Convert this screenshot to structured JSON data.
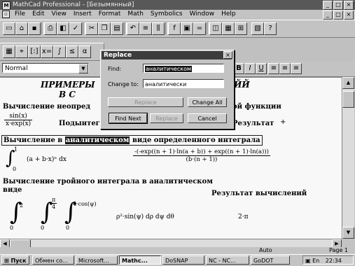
{
  "window": {
    "title": "MathCad Professional - [Безымянный]",
    "controls": [
      "_",
      "□",
      "×"
    ]
  },
  "menubar": {
    "items": [
      "File",
      "Edit",
      "View",
      "Insert",
      "Format",
      "Math",
      "Symbolics",
      "Window",
      "Help"
    ]
  },
  "format_bar": {
    "style_value": "Normal",
    "bold": "B",
    "italic": "I",
    "underline": "U"
  },
  "document": {
    "heading1": "ПРИМЕРЫ",
    "heading1_end": "ЙЙ",
    "heading2": "В С",
    "line1_left": "Вычисление неопред",
    "line1_right": "ой функции",
    "frac1_num": "sin(x)",
    "frac1_den": "x·exp(x)",
    "line2_mid": "Подынтегр",
    "line2_right": "Результат",
    "line3_pre": "Вычисление в",
    "line3_highlight": "аналитическом",
    "line3_post": "виде определенного интеграла",
    "int1_upper": "1",
    "int1_lower": "0",
    "int1_body": "(a + b·x)ⁿ dx",
    "int1_result_num": "-(-exp((n + 1)·ln(a + b)) + exp((n + 1)·ln(a)))",
    "int1_result_den": "(b·(n + 1))",
    "line4": "Вычисление тройного интеграла в аналитическом",
    "line5": "виде",
    "line5_right": "Результат вычислений",
    "int2_upper": "2",
    "int2_lower": "0",
    "int3_upper": "π",
    "int3_upper_den": "4",
    "int3_lower": "0",
    "int4_upper": "4·cos(ψ)",
    "int4_lower": "0",
    "triple_body": "ρ²·sin(ψ) dρ dψ dθ",
    "triple_result": "2·π"
  },
  "dialog": {
    "title": "Replace",
    "find_label": "Find:",
    "find_value": "аналитическом",
    "change_label": "Change to:",
    "change_value": "аналитически",
    "btn_replace": "Replace",
    "btn_find_next": "Find Next",
    "btn_change_all": "Change All",
    "btn_cancel": "Cancel"
  },
  "statusbar": {
    "mode": "Auto",
    "page": "Page 1"
  },
  "taskbar": {
    "start": "Пуск",
    "tasks": [
      "Обмен со...",
      "Microsoft...",
      "Mathc...",
      "DoSNAP",
      "NC - NC...",
      "GoDOT"
    ],
    "clock": "22:34"
  }
}
